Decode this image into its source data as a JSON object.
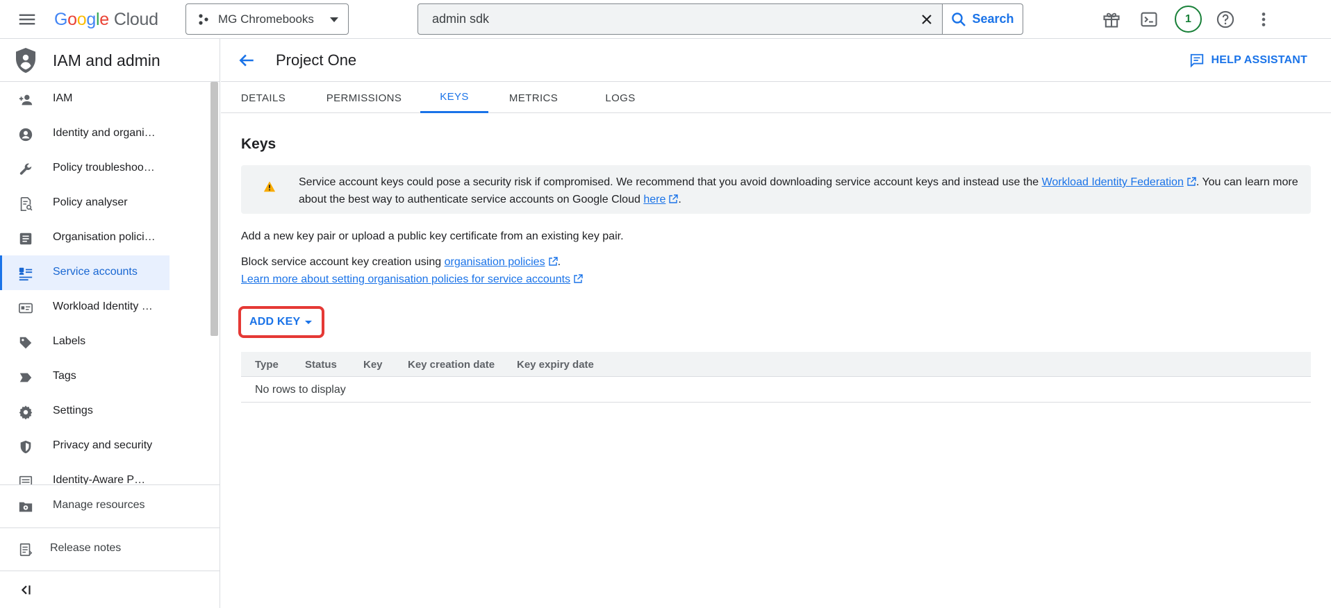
{
  "topbar": {
    "logo_google": [
      "G",
      "o",
      "o",
      "g",
      "l",
      "e"
    ],
    "logo_cloud": "Cloud",
    "project": "MG Chromebooks",
    "search_value": "admin sdk",
    "search_button": "Search",
    "notification_count": "1"
  },
  "sidebar": {
    "title": "IAM and admin",
    "items": [
      {
        "label": "IAM",
        "icon": "person-add-icon"
      },
      {
        "label": "Identity and organi…",
        "icon": "account-circle-icon"
      },
      {
        "label": "Policy troubleshoo…",
        "icon": "wrench-icon"
      },
      {
        "label": "Policy analyser",
        "icon": "document-search-icon"
      },
      {
        "label": "Organisation polici…",
        "icon": "list-alt-icon"
      },
      {
        "label": "Service accounts",
        "icon": "service-account-icon",
        "active": true
      },
      {
        "label": "Workload Identity …",
        "icon": "badge-icon"
      },
      {
        "label": "Labels",
        "icon": "tag-icon"
      },
      {
        "label": "Tags",
        "icon": "label-arrow-icon"
      },
      {
        "label": "Settings",
        "icon": "gear-icon"
      },
      {
        "label": "Privacy and security",
        "icon": "shield-icon"
      },
      {
        "label": "Identity-Aware P…",
        "icon": "list-icon"
      }
    ],
    "manage_resources": "Manage resources",
    "release_notes": "Release notes"
  },
  "main": {
    "page_title": "Project One",
    "help_assistant": "HELP ASSISTANT",
    "tabs": [
      {
        "label": "DETAILS"
      },
      {
        "label": "PERMISSIONS"
      },
      {
        "label": "KEYS",
        "active": true
      },
      {
        "label": "METRICS"
      },
      {
        "label": "LOGS"
      }
    ],
    "section_title": "Keys",
    "alert": {
      "text_before": "Service account keys could pose a security risk if compromised. We recommend that you avoid downloading service account keys and instead use the ",
      "link1": "Workload Identity Federation",
      "text_middle": ". You can learn more about the best way to authenticate service accounts on Google Cloud ",
      "link2": "here",
      "text_after": "."
    },
    "add_key_intro": "Add a new key pair or upload a public key certificate from an existing key pair.",
    "block_text": "Block service account key creation using ",
    "block_link": "organisation policies",
    "block_end": ".",
    "learn_more": "Learn more about setting organisation policies for service accounts",
    "add_key_button": "ADD KEY",
    "table": {
      "columns": [
        "Type",
        "Status",
        "Key",
        "Key creation date",
        "Key expiry date"
      ],
      "empty": "No rows to display"
    }
  },
  "colors": {
    "accent": "#1a73e8",
    "highlight_frame": "#e53935",
    "warning": "#f9ab00",
    "notification": "#188038"
  }
}
